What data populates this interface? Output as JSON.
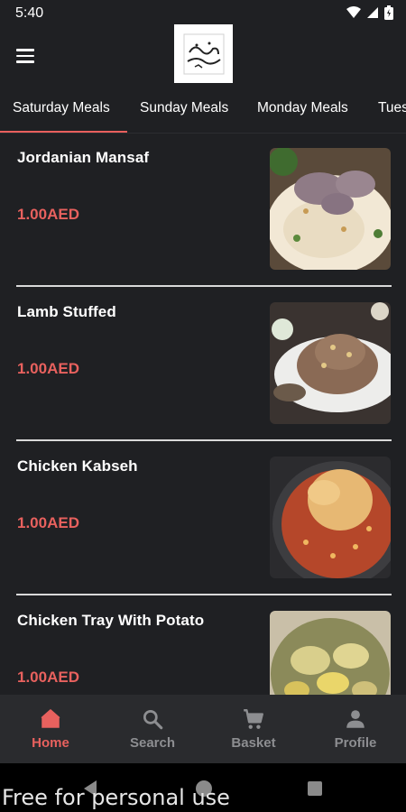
{
  "status_bar": {
    "time": "5:40"
  },
  "tabs": [
    {
      "label": "Saturday Meals"
    },
    {
      "label": "Sunday Meals"
    },
    {
      "label": "Monday Meals"
    },
    {
      "label": "Tues"
    }
  ],
  "meals": [
    {
      "name": "Jordanian Mansaf",
      "price": "1.00AED"
    },
    {
      "name": "Lamb Stuffed",
      "price": "1.00AED"
    },
    {
      "name": "Chicken Kabseh",
      "price": "1.00AED"
    },
    {
      "name": "Chicken Tray With Potato",
      "price": "1.00AED"
    }
  ],
  "bottom_nav": [
    {
      "label": "Home",
      "icon": "home-icon",
      "active": true
    },
    {
      "label": "Search",
      "icon": "search-icon",
      "active": false
    },
    {
      "label": "Basket",
      "icon": "cart-icon",
      "active": false
    },
    {
      "label": "Profile",
      "icon": "person-icon",
      "active": false
    }
  ],
  "watermark": "Free for personal use",
  "colors": {
    "accent": "#e8615e",
    "background": "#1f2023",
    "nav_background": "#2a2b2e",
    "inactive": "#8d8e91"
  }
}
